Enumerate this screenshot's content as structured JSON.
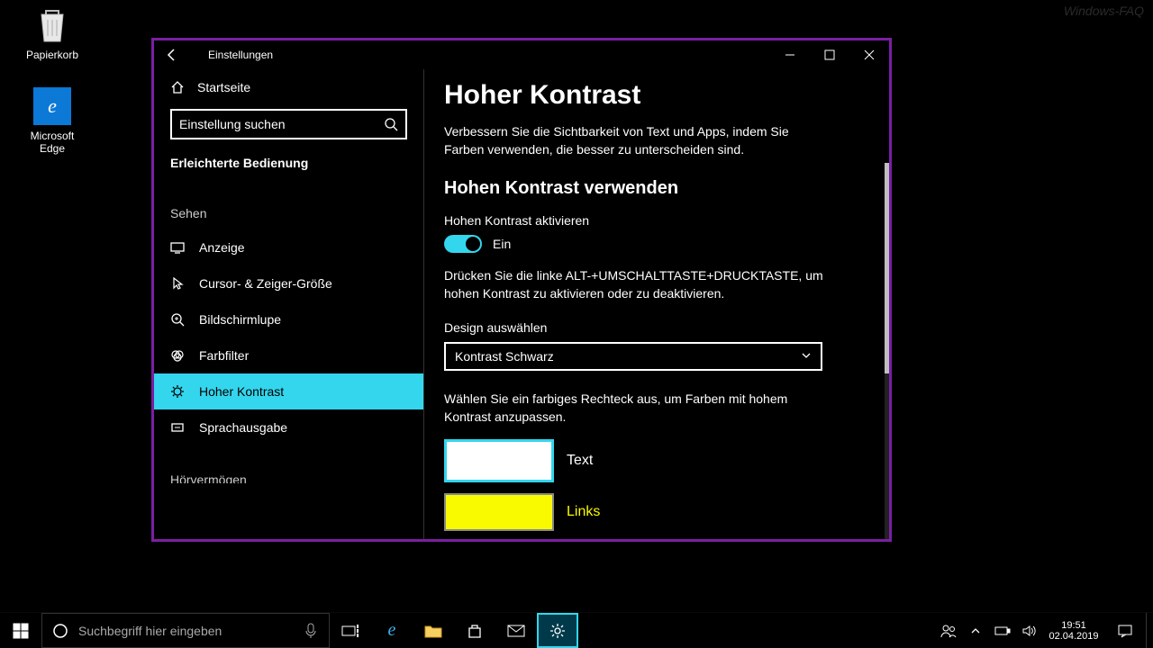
{
  "desktop": {
    "recycle": "Papierkorb",
    "edge": "Microsoft Edge"
  },
  "watermark": "Windows-FAQ",
  "window": {
    "title": "Einstellungen",
    "home": "Startseite",
    "search_placeholder": "Einstellung suchen",
    "category": "Erleichterte Bedienung",
    "section": "Sehen",
    "items": {
      "display": "Anzeige",
      "cursor": "Cursor- & Zeiger-Größe",
      "magnifier": "Bildschirmlupe",
      "colorfilter": "Farbfilter",
      "highcontrast": "Hoher Kontrast",
      "narrator": "Sprachausgabe"
    },
    "cutoff": "Hörvermögen"
  },
  "content": {
    "title": "Hoher Kontrast",
    "desc": "Verbessern Sie die Sichtbarkeit von Text und Apps, indem Sie Farben verwenden, die besser zu unterscheiden sind.",
    "use_heading": "Hohen Kontrast verwenden",
    "activate_label": "Hohen Kontrast aktivieren",
    "toggle_state": "Ein",
    "hint": "Drücken Sie die linke ALT-+UMSCHALTTASTE+DRUCKTASTE, um hohen Kontrast zu aktivieren oder zu deaktivieren.",
    "select_label": "Design auswählen",
    "select_value": "Kontrast Schwarz",
    "color_hint": "Wählen Sie ein farbiges Rechteck aus, um Farben mit hohem Kontrast anzupassen.",
    "color_text": "Text",
    "color_links": "Links"
  },
  "taskbar": {
    "search_placeholder": "Suchbegriff hier eingeben",
    "time": "19:51",
    "date": "02.04.2019"
  }
}
